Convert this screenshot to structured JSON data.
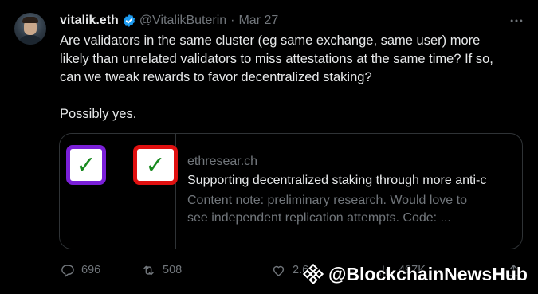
{
  "author": {
    "name": "vitalik.eth",
    "handle": "@VitalikButerin",
    "separator": "·",
    "date": "Mar 27"
  },
  "post": {
    "line1": "Are validators in the same cluster (eg same exchange, same user) more",
    "line2": "likely than unrelated validators to miss attestations at the same time? If so,",
    "line3": "can we tweak rewards to favor decentralized staking?",
    "line4": "Possibly yes."
  },
  "card": {
    "thumb_check_left": "✓",
    "thumb_check_right": "✓",
    "domain": "ethresear.ch",
    "title": "Supporting decentralized staking through more anti-c",
    "desc_line1": "Content note: preliminary research. Would love to",
    "desc_line2": "see independent replication attempts. Code: ..."
  },
  "actions": {
    "replies": "696",
    "reposts": "508",
    "likes": "2.6",
    "views": "497K"
  },
  "watermark": {
    "text": "@BlockchainNewsHub"
  },
  "icons": {
    "verified": "verified-badge-icon",
    "more": "more-icon",
    "reply": "reply-icon",
    "repost": "repost-icon",
    "like": "heart-icon",
    "views": "views-icon",
    "watermark_logo": "binance-logo-icon"
  },
  "colors": {
    "background": "#000000",
    "text_primary": "#e7e9ea",
    "text_secondary": "#71767b",
    "border": "#2f3336",
    "verified_blue": "#1d9bf0",
    "check_green": "#188a1f",
    "thumb_purple": "#7a1fd8",
    "thumb_red": "#e01010"
  }
}
